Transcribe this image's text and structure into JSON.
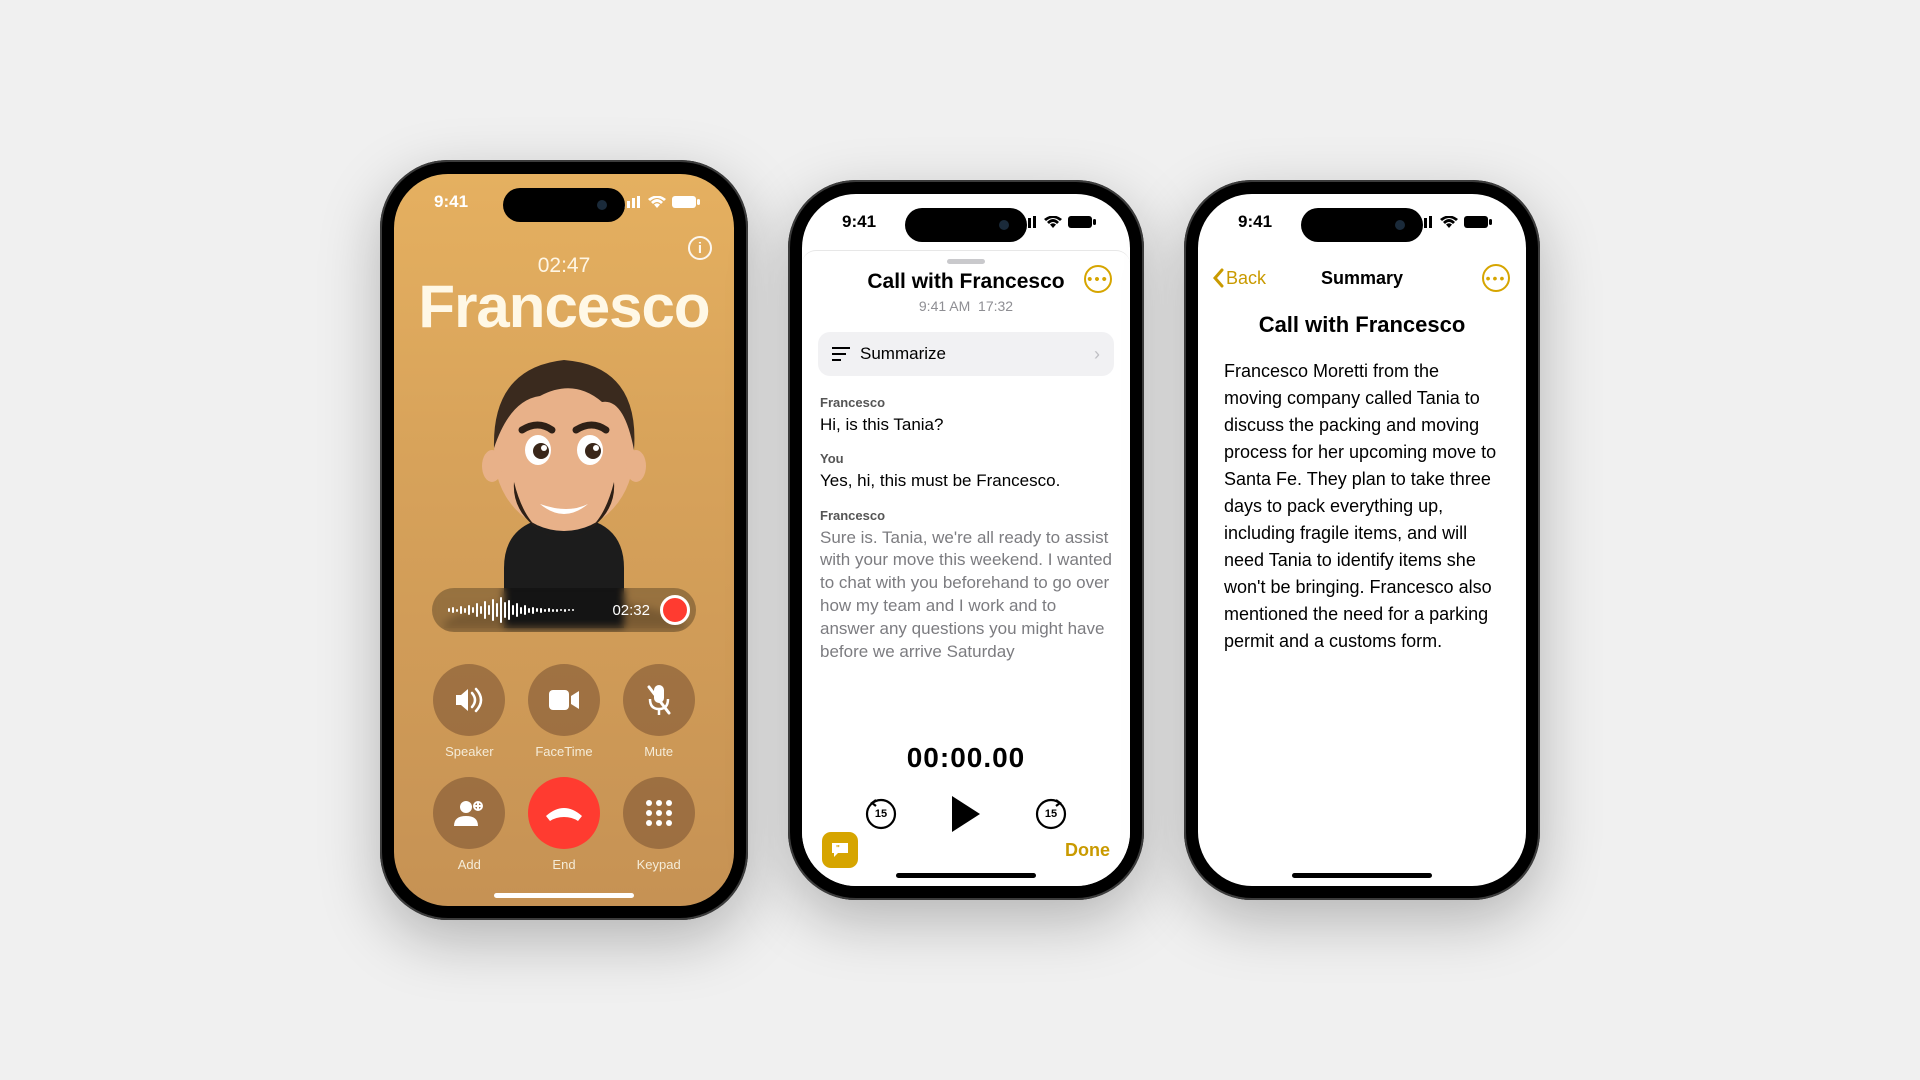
{
  "status": {
    "time": "9:41"
  },
  "phone1": {
    "call_duration": "02:47",
    "caller_name": "Francesco",
    "info_glyph": "i",
    "recording": {
      "elapsed": "02:32"
    },
    "buttons": {
      "speaker": "Speaker",
      "facetime": "FaceTime",
      "mute": "Mute",
      "add": "Add",
      "end": "End",
      "keypad": "Keypad"
    }
  },
  "phone2": {
    "title": "Call with Francesco",
    "meta_time": "9:41 AM",
    "meta_duration": "17:32",
    "summarize_label": "Summarize",
    "more_glyph": "•••",
    "transcript": [
      {
        "speaker": "Francesco",
        "line": "Hi, is this Tania?"
      },
      {
        "speaker": "You",
        "line": "Yes, hi, this must be Francesco."
      },
      {
        "speaker": "Francesco",
        "line": "Sure is. Tania, we're all ready to assist with your move this weekend. I wanted to chat with you beforehand to go over how my team and I work and to answer any questions you might have before we arrive Saturday"
      }
    ],
    "playback_time": "00:00.00",
    "skip_amount": "15",
    "done_label": "Done"
  },
  "phone3": {
    "back_label": "Back",
    "nav_title": "Summary",
    "more_glyph": "•••",
    "title": "Call with Francesco",
    "body": "Francesco Moretti from the moving company called Tania to discuss the packing and moving process for her upcoming move to Santa Fe. They plan to take three days to pack everything up, including fragile items, and will need Tania to identify items she won't be bringing. Francesco also mentioned the need for a parking permit and a customs form."
  },
  "colors": {
    "accent_yellow": "#c99a00",
    "end_call_red": "#ff3b30"
  }
}
